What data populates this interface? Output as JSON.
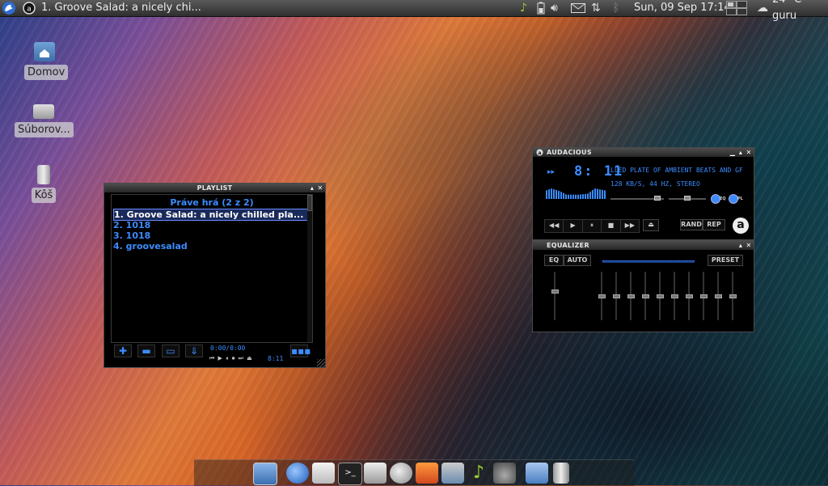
{
  "panel": {
    "window_title": "1. Groove Salad: a nicely chi...",
    "datetime": "Sun, 09 Sep  17:14",
    "weather": "24 °C guru"
  },
  "desktop": {
    "icons": [
      {
        "label": "Domov"
      },
      {
        "label": "Súborov..."
      },
      {
        "label": "Kôš"
      }
    ]
  },
  "playlist": {
    "title": "PLAYLIST",
    "now_playing": "Práve hrá (2 z 2)",
    "items": [
      "1. Groove Salad: a nicely chilled pla...",
      "2. 1018",
      "3. 1018",
      "4. groovesalad"
    ],
    "time_pos": "0:00/0:00",
    "time_total": "8:11"
  },
  "audacious": {
    "title": "AUDACIOUS",
    "time": "8: 11",
    "marquee": "LLED PLATE OF AMBIENT BEATS AND GF",
    "info": "128 KB/S, 44 HZ, STEREO",
    "eq_toggle": "EQ",
    "pl_toggle": "PL",
    "rand": "RAND",
    "rep": "REP"
  },
  "equalizer": {
    "title": "EQUALIZER",
    "eq": "EQ",
    "auto": "AUTO",
    "preset": "PRESET",
    "preamp_level": 0.5,
    "band_levels": [
      0.5,
      0.5,
      0.5,
      0.5,
      0.5,
      0.5,
      0.5,
      0.5,
      0.5,
      0.5
    ]
  },
  "colors": {
    "accent_blue": "#3b8cff",
    "panel_dark": "#2e2e2e"
  }
}
